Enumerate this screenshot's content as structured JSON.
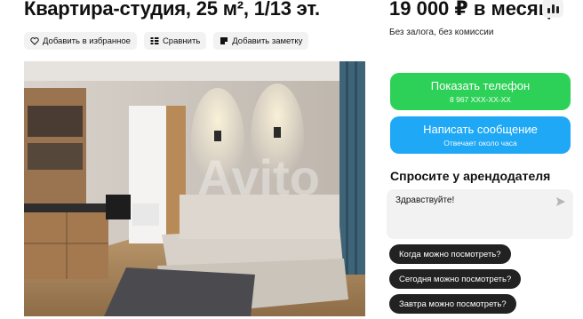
{
  "listing": {
    "title": "Квартира-студия, 25 м², 1/13 эт.",
    "price": "19 000 ₽ в месяц",
    "terms": "Без залога, без комиссии"
  },
  "actions": {
    "favorite": "Добавить в избранное",
    "compare": "Сравнить",
    "note": "Добавить заметку"
  },
  "photo": {
    "watermark": "Avito"
  },
  "contact": {
    "show_phone_label": "Показать телефон",
    "phone_masked": "8 967 XXX-XX-XX",
    "message_label": "Написать сообщение",
    "reply_time": "Отвечает около часа"
  },
  "ask": {
    "heading": "Спросите у арендодателя",
    "message_value": "Здравствуйте!",
    "quick_questions": [
      "Когда можно посмотреть?",
      "Сегодня можно посмотреть?",
      "Завтра можно посмотреть?"
    ]
  },
  "colors": {
    "green": "#2ed158",
    "blue": "#1ea8f5",
    "chip": "#222222"
  }
}
